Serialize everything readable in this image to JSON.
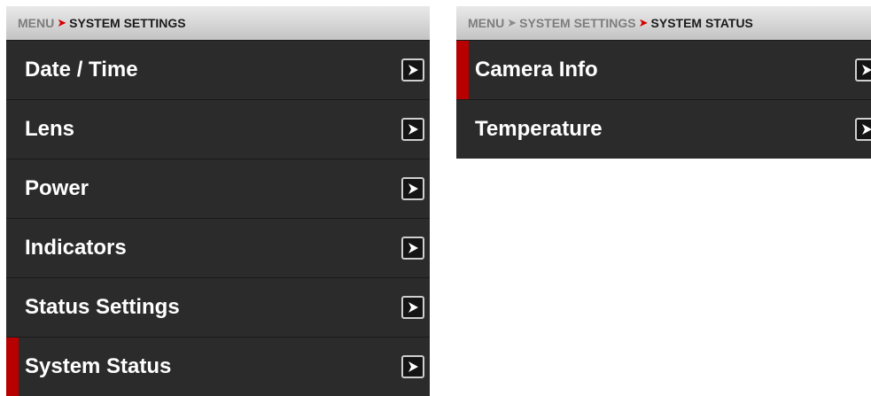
{
  "left_panel": {
    "breadcrumb": [
      {
        "label": "MENU"
      },
      {
        "label": "SYSTEM SETTINGS",
        "current": true
      }
    ],
    "items": [
      {
        "label": "Date / Time",
        "selected": false
      },
      {
        "label": "Lens",
        "selected": false
      },
      {
        "label": "Power",
        "selected": false
      },
      {
        "label": "Indicators",
        "selected": false
      },
      {
        "label": "Status Settings",
        "selected": false
      },
      {
        "label": "System Status",
        "selected": true
      }
    ]
  },
  "right_panel": {
    "breadcrumb": [
      {
        "label": "MENU"
      },
      {
        "label": "SYSTEM SETTINGS"
      },
      {
        "label": "SYSTEM STATUS",
        "current": true
      }
    ],
    "items": [
      {
        "label": "Camera Info",
        "selected": true
      },
      {
        "label": "Temperature",
        "selected": false
      }
    ]
  },
  "colors": {
    "accent": "#d40000",
    "selection_bar": "#b80000",
    "panel_background": "#2b2b2b",
    "header_background": "#d6d6d6"
  },
  "icons": {
    "separator": "chevron-right-icon",
    "item_arrow": "arrow-right-icon"
  }
}
